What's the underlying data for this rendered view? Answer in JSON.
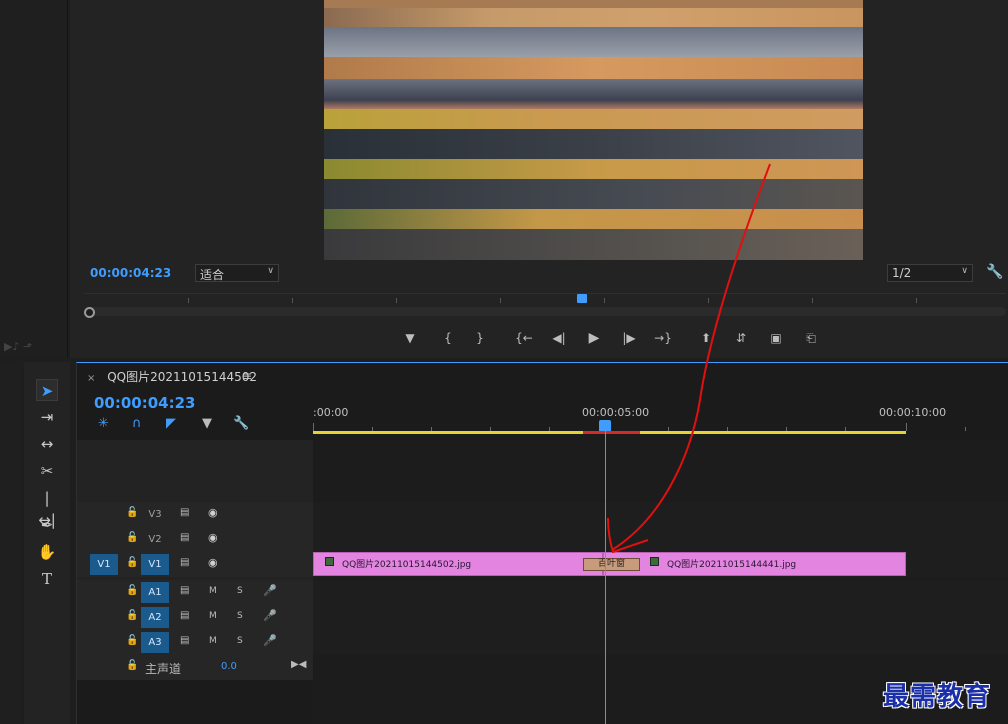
{
  "program_monitor": {
    "timecode": "00:00:04:23",
    "fit_dropdown": "适合",
    "resolution_dropdown": "1/2"
  },
  "timeline": {
    "tab_close": "×",
    "sequence_name": "QQ图片20211015144502",
    "menu_icon": "≡",
    "timecode": "00:00:04:23",
    "ruler": [
      ":00:00",
      "00:00:05:00",
      "00:00:10:00"
    ],
    "tracks": {
      "v3": "V3",
      "v2": "V2",
      "v1": "V1",
      "v1_source": "V1",
      "a1": "A1",
      "a2": "A2",
      "a3": "A3",
      "mute": "M",
      "solo": "S",
      "master_label": "主声道",
      "master_value": "0.0"
    },
    "clips": {
      "clip1_name": "QQ图片20211015144502.jpg",
      "clip2_name": "QQ图片20211015144441.jpg",
      "transition_name": "百叶窗"
    }
  },
  "watermark": "最需教育",
  "colors": {
    "accent": "#3f9dff",
    "clip": "#e284e0",
    "work_area": "#e6d331",
    "annotation": "#e01010"
  }
}
